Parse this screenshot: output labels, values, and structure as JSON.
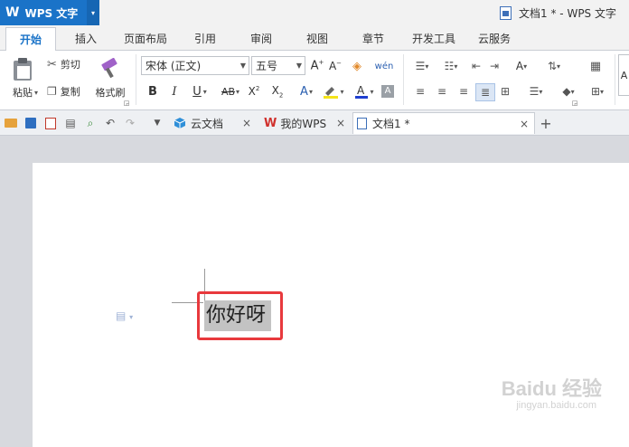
{
  "app": {
    "logo": "W",
    "name": "WPS 文字",
    "menu_arrow": "▾"
  },
  "window": {
    "title": "文档1 * - WPS 文字"
  },
  "ribbon_tabs": [
    "开始",
    "插入",
    "页面布局",
    "引用",
    "审阅",
    "视图",
    "章节",
    "开发工具",
    "云服务"
  ],
  "clipboard": {
    "paste": "粘贴",
    "cut": "剪切",
    "copy": "复制",
    "format_painter": "格式刷"
  },
  "font": {
    "name": "宋体 (正文)",
    "size": "五号"
  },
  "doc_tabs": [
    {
      "label": "云文档"
    },
    {
      "label": "我的WPS"
    },
    {
      "label": "文档1 *"
    }
  ],
  "document": {
    "selected_text": "你好呀"
  },
  "watermark": {
    "brand": "Baidu 经验",
    "url": "jingyan.baidu.com"
  },
  "colors": {
    "accent": "#1a73c8",
    "highlight_box": "#e8393d",
    "font_color": "#1f3fd0",
    "highlight_color": "#f4e31a"
  }
}
